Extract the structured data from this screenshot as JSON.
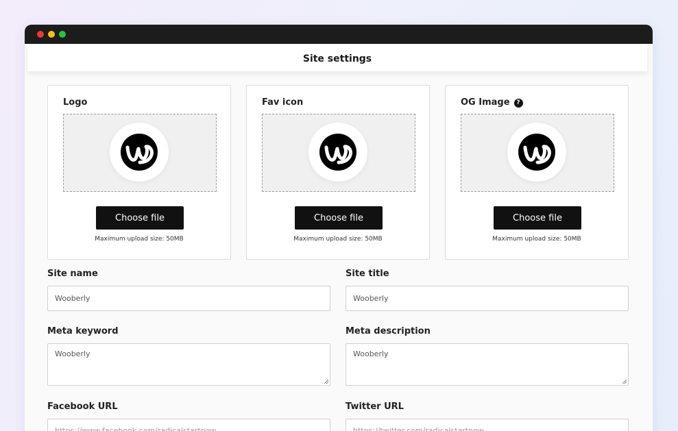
{
  "window": {
    "title": "Site settings"
  },
  "media_cards": [
    {
      "label": "Logo",
      "button_label": "Choose file",
      "hint": "Maximum upload size: 50MB",
      "icon": "wooberly-logo"
    },
    {
      "label": "Fav icon",
      "button_label": "Choose file",
      "hint": "Maximum upload size: 50MB",
      "icon": "wooberly-logo"
    },
    {
      "label": "OG Image",
      "help_glyph": "?",
      "button_label": "Choose file",
      "hint": "Maximum upload size: 50MB",
      "icon": "wooberly-logo"
    }
  ],
  "fields": {
    "site_name": {
      "label": "Site name",
      "value": "Wooberly"
    },
    "site_title": {
      "label": "Site title",
      "value": "Wooberly"
    },
    "meta_keyword": {
      "label": "Meta keyword",
      "value": "Wooberly"
    },
    "meta_description": {
      "label": "Meta description",
      "value": "Wooberly"
    },
    "facebook_url": {
      "label": "Facebook URL",
      "value": "https://www.facebook.com/radicalstartnow"
    },
    "twitter_url": {
      "label": "Twitter URL",
      "value": "https://twitter.com/radicalstartnow"
    }
  },
  "colors": {
    "button_bg": "#111111",
    "titlebar_bg": "#1c1c1c",
    "traffic_red": "#ec3a32",
    "traffic_yellow": "#f2c010",
    "traffic_green": "#28c23f"
  }
}
